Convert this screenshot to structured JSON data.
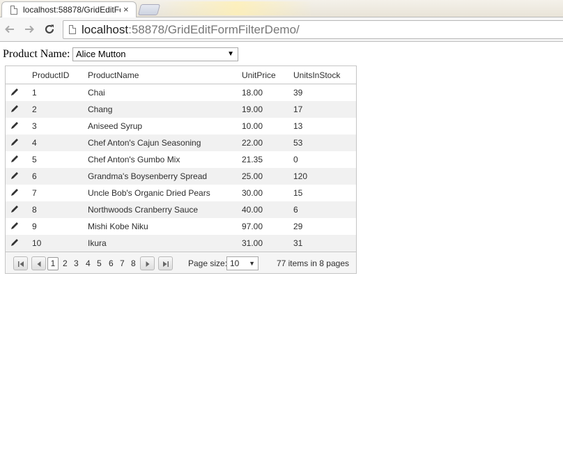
{
  "browser": {
    "tab_title": "localhost:58878/GridEditFo",
    "tab_close": "×",
    "url_host": "localhost",
    "url_rest": ":58878/GridEditFormFilterDemo/"
  },
  "filter": {
    "label": "Product Name:",
    "selected": "Alice Mutton"
  },
  "grid": {
    "columns": [
      "ProductID",
      "ProductName",
      "UnitPrice",
      "UnitsInStock"
    ],
    "rows": [
      {
        "id": "1",
        "name": "Chai",
        "price": "18.00",
        "stock": "39"
      },
      {
        "id": "2",
        "name": "Chang",
        "price": "19.00",
        "stock": "17"
      },
      {
        "id": "3",
        "name": "Aniseed Syrup",
        "price": "10.00",
        "stock": "13"
      },
      {
        "id": "4",
        "name": "Chef Anton's Cajun Seasoning",
        "price": "22.00",
        "stock": "53"
      },
      {
        "id": "5",
        "name": "Chef Anton's Gumbo Mix",
        "price": "21.35",
        "stock": "0"
      },
      {
        "id": "6",
        "name": "Grandma's Boysenberry Spread",
        "price": "25.00",
        "stock": "120"
      },
      {
        "id": "7",
        "name": "Uncle Bob's Organic Dried Pears",
        "price": "30.00",
        "stock": "15"
      },
      {
        "id": "8",
        "name": "Northwoods Cranberry Sauce",
        "price": "40.00",
        "stock": "6"
      },
      {
        "id": "9",
        "name": "Mishi Kobe Niku",
        "price": "97.00",
        "stock": "29"
      },
      {
        "id": "10",
        "name": "Ikura",
        "price": "31.00",
        "stock": "31"
      }
    ]
  },
  "pager": {
    "pages": [
      "1",
      "2",
      "3",
      "4",
      "5",
      "6",
      "7",
      "8"
    ],
    "current_page": "1",
    "page_size_label": "Page size:",
    "page_size": "10",
    "info": "77 items in 8 pages"
  },
  "colors": {
    "row_alt": "#f1f1f1",
    "border": "#c5c5c5",
    "text": "#2e2e2e"
  }
}
